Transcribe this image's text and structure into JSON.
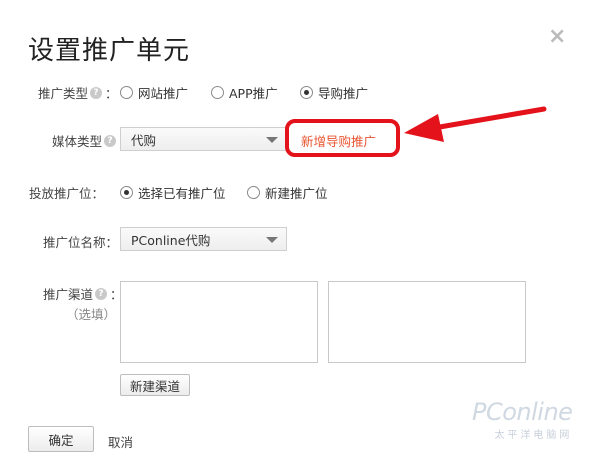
{
  "dialog": {
    "title": "设置推广单元",
    "close_label": "×",
    "help_glyph": "?",
    "colon": "："
  },
  "promo_type": {
    "label": "推广类型",
    "options": [
      "网站推广",
      "APP推广",
      "导购推广"
    ],
    "selected": "导购推广"
  },
  "media_type": {
    "label": "媒体类型",
    "value": "代购",
    "new_link": "新增导购推广"
  },
  "placement": {
    "label": "投放推广位",
    "options": [
      "选择已有推广位",
      "新建推广位"
    ],
    "selected": "选择已有推广位"
  },
  "placement_name": {
    "label": "推广位名称：",
    "value": "PConline代购"
  },
  "channel": {
    "label": "推广渠道",
    "optional": "（选填）",
    "new_button": "新建渠道"
  },
  "footer": {
    "confirm": "确定",
    "cancel": "取消"
  },
  "watermark": {
    "logo": "PConline",
    "tagline": "太平洋电脑网"
  },
  "colors": {
    "accent_link": "#e8542f",
    "annotation_red": "#e3121b"
  }
}
